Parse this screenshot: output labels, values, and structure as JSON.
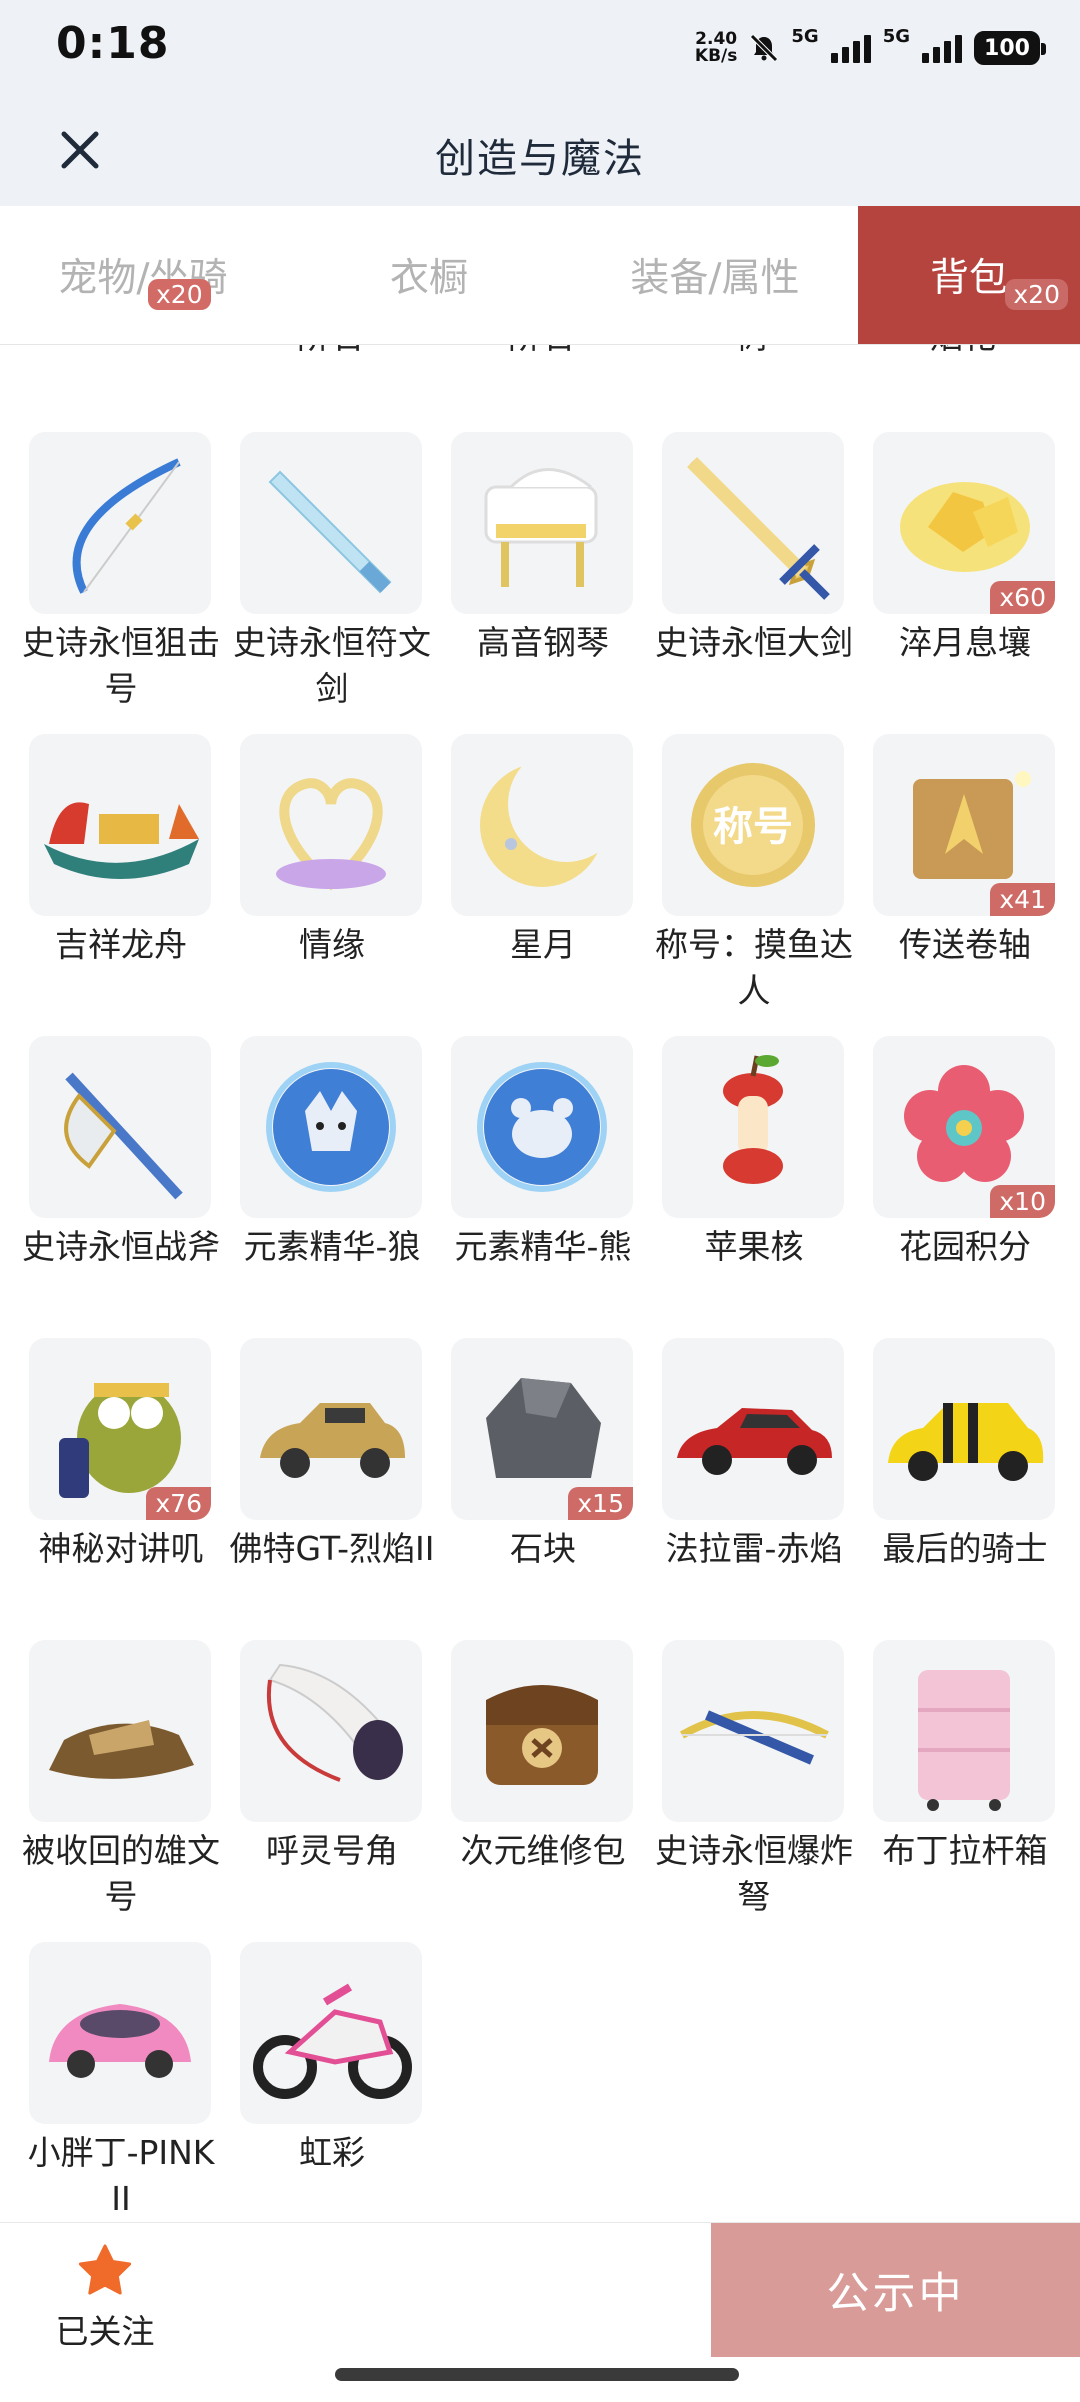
{
  "status_bar": {
    "time": "0:18",
    "net_speed_value": "2.40",
    "net_speed_unit": "KB/s",
    "signal1_label": "5G",
    "signal2_label": "5G",
    "battery": "100",
    "icons": [
      "mute-bell-icon",
      "signal-icon",
      "signal-icon",
      "battery-icon"
    ]
  },
  "header": {
    "title": "创造与魔法",
    "close_icon": "close-icon"
  },
  "tabs": [
    {
      "label": "宠物/坐骑",
      "badge": "x20",
      "active": false
    },
    {
      "label": "衣橱",
      "badge": "",
      "active": false
    },
    {
      "label": "装备/属性",
      "badge": "",
      "active": false
    },
    {
      "label": "背包",
      "badge": "x20",
      "active": true
    }
  ],
  "partial_row": [
    {
      "line2": ""
    },
    {
      "line2": "阶石"
    },
    {
      "line2": "阶石"
    },
    {
      "line2": "树"
    },
    {
      "line2": "烟花"
    }
  ],
  "items": [
    {
      "name": "史诗永恒狙击号",
      "qty": "",
      "icon": "bow-icon"
    },
    {
      "name": "史诗永恒符文剑",
      "qty": "",
      "icon": "rune-sword-icon"
    },
    {
      "name": "高音钢琴",
      "qty": "",
      "icon": "piano-icon"
    },
    {
      "name": "史诗永恒大剑",
      "qty": "",
      "icon": "greatsword-icon"
    },
    {
      "name": "淬月息壤",
      "qty": "x60",
      "icon": "gold-ore-icon"
    },
    {
      "name": "吉祥龙舟",
      "qty": "",
      "icon": "dragon-boat-icon"
    },
    {
      "name": "情缘",
      "qty": "",
      "icon": "heart-frame-icon"
    },
    {
      "name": "星月",
      "qty": "",
      "icon": "crescent-moon-icon"
    },
    {
      "name": "称号：摸鱼达人",
      "qty": "",
      "icon": "title-badge-icon"
    },
    {
      "name": "传送卷轴",
      "qty": "x41",
      "icon": "teleport-scroll-icon"
    },
    {
      "name": "史诗永恒战斧",
      "qty": "",
      "icon": "battle-axe-icon"
    },
    {
      "name": "元素精华-狼",
      "qty": "",
      "icon": "wolf-orb-icon"
    },
    {
      "name": "元素精华-熊",
      "qty": "",
      "icon": "bear-orb-icon"
    },
    {
      "name": "苹果核",
      "qty": "",
      "icon": "apple-core-icon"
    },
    {
      "name": "花园积分",
      "qty": "x10",
      "icon": "flower-token-icon"
    },
    {
      "name": "神秘对讲叽",
      "qty": "x76",
      "icon": "walkie-talkie-bird-icon"
    },
    {
      "name": "佛特GT-烈焰II",
      "qty": "",
      "icon": "vintage-car-icon"
    },
    {
      "name": "石块",
      "qty": "x15",
      "icon": "stone-icon"
    },
    {
      "name": "法拉雷-赤焰",
      "qty": "",
      "icon": "red-sports-car-icon"
    },
    {
      "name": "最后的骑士",
      "qty": "",
      "icon": "yellow-sports-car-icon"
    },
    {
      "name": "被收回的雄文号",
      "qty": "",
      "icon": "wrecked-ship-icon"
    },
    {
      "name": "呼灵号角",
      "qty": "",
      "icon": "horn-icon"
    },
    {
      "name": "次元维修包",
      "qty": "",
      "icon": "repair-bag-icon"
    },
    {
      "name": "史诗永恒爆炸弩",
      "qty": "",
      "icon": "crossbow-icon"
    },
    {
      "name": "布丁拉杆箱",
      "qty": "",
      "icon": "suitcase-icon"
    },
    {
      "name": "小胖丁-PINK II",
      "qty": "",
      "icon": "pink-car-icon"
    },
    {
      "name": "虹彩",
      "qty": "",
      "icon": "motorcycle-icon"
    }
  ],
  "bottom": {
    "follow_label": "已关注",
    "follow_icon": "star-icon",
    "publish_label": "公示中"
  },
  "colors": {
    "accent": "#b5443f",
    "badge": "#cf6b66",
    "publish_button": "#d89b98",
    "header_bg": "#eef2f6"
  }
}
